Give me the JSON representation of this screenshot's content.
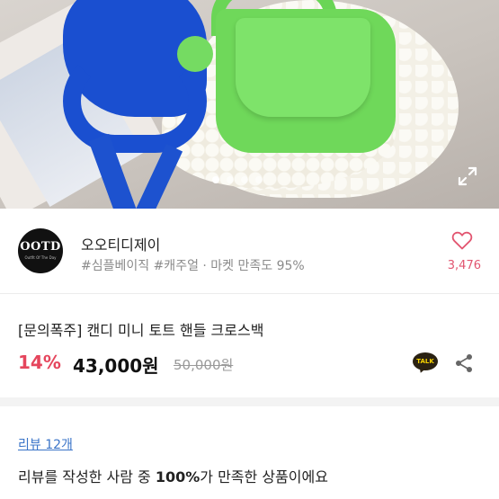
{
  "hero": {
    "carousel": {
      "count": 4,
      "active_index": 0
    },
    "icon": "expand-icon"
  },
  "seller": {
    "avatar": {
      "line1": "OOTD",
      "line2": "Outfit Of The Day",
      "bg": "#111111"
    },
    "name": "오오티디제이",
    "tags": "#심플베이직 #캐주얼 · 마켓 만족도 95%",
    "likes": "3,476",
    "heart_icon": "heart-icon",
    "accent": "#e25570"
  },
  "product": {
    "title": "[문의폭주] 캔디 미니 토트 핸들 크로스백",
    "discount": "14%",
    "price": "43,000원",
    "original_price": "50,000원",
    "talk_label": "TALK",
    "discount_color": "#e5465d"
  },
  "review": {
    "link": "리뷰 12개",
    "summary_prefix": "리뷰를 작성한 사람 중 ",
    "summary_bold": "100%",
    "summary_suffix": "가 만족한 상품이에요",
    "link_color": "#3a74c8"
  }
}
